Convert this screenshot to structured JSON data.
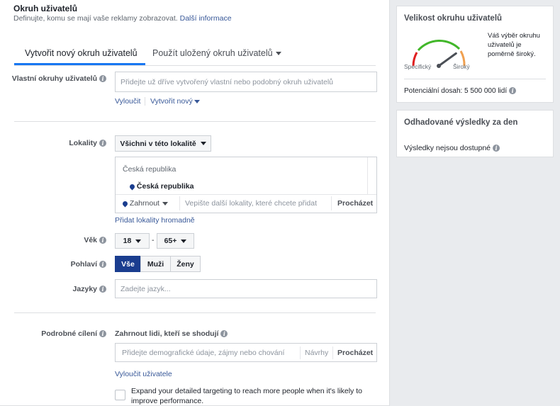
{
  "header": {
    "title": "Okruh uživatelů",
    "subtitle": "Definujte, komu se mají vaše reklamy zobrazovat.",
    "more_link": "Další informace"
  },
  "tabs": [
    {
      "label": "Vytvořit nový okruh uživatelů",
      "active": true
    },
    {
      "label": "Použít uložený okruh uživatelů",
      "active": false
    }
  ],
  "custom_audiences": {
    "label": "Vlastní okruhy uživatelů",
    "placeholder": "Přidejte už dříve vytvořený vlastní nebo podobný okruh uživatelů",
    "exclude_link": "Vyloučit",
    "create_link": "Vytvořit nový"
  },
  "locations": {
    "label": "Lokality",
    "dropdown": "Všichni v této lokalitě",
    "group_header": "Česká republika",
    "selected": "Česká republika",
    "include_dropdown": "Zahrnout",
    "search_placeholder": "Vepište další lokality, které chcete přidat",
    "browse": "Procházet",
    "bulk_link": "Přidat lokality hromadně"
  },
  "age": {
    "label": "Věk",
    "min": "18",
    "separator": "-",
    "max": "65+"
  },
  "gender": {
    "label": "Pohlaví",
    "options": [
      "Vše",
      "Muži",
      "Ženy"
    ],
    "selected": "Vše"
  },
  "languages": {
    "label": "Jazyky",
    "placeholder": "Zadejte jazyk..."
  },
  "detailed_targeting": {
    "label": "Podrobné cílení",
    "include_label": "Zahrnout lidi, kteří se shodují",
    "placeholder": "Přidejte demografické údaje, zájmy nebo chování",
    "suggestions": "Návrhy",
    "browse": "Procházet",
    "exclude_link": "Vyloučit uživatele",
    "expand_text_line1": "Expand your detailed targeting to reach more people when it's likely to",
    "expand_text_line2": "improve performance.",
    "expand_checked": false
  },
  "audience_size": {
    "title": "Velikost okruhu uživatelů",
    "gauge_left": "Specifický",
    "gauge_right": "Široký",
    "description_line1": "Váš výběr okruhu",
    "description_line2": "uživatelů je",
    "description_line3": "poměrně široký.",
    "reach_label": "Potenciální dosah: 5 500 000 lidí",
    "gauge_level": 0.8,
    "colors": {
      "low": "#e02020",
      "mid": "#42b72a",
      "high": "#f0a050"
    }
  },
  "estimated_results": {
    "title": "Odhadované výsledky za den",
    "status": "Výsledky nejsou dostupné"
  }
}
